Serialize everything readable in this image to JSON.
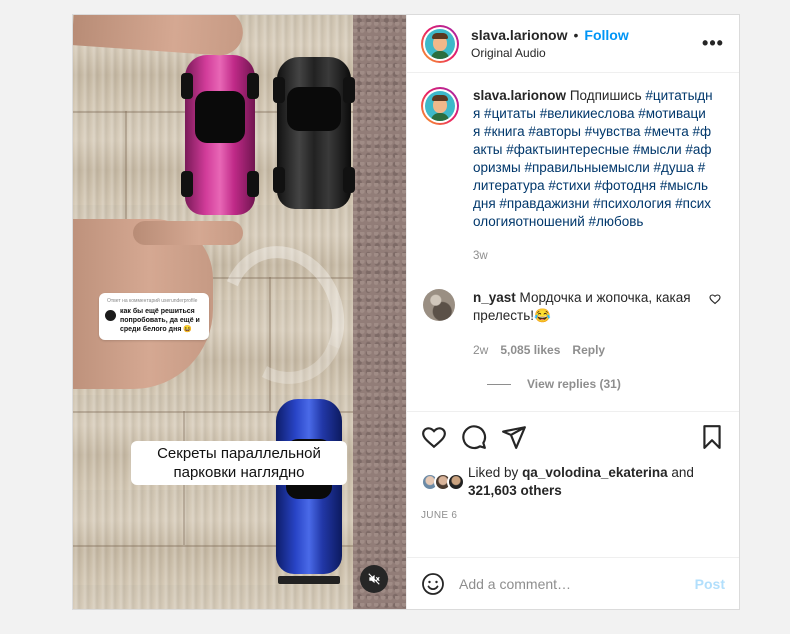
{
  "header": {
    "username": "slava.larionow",
    "separator": "•",
    "follow_label": "Follow",
    "audio_label": "Original Audio",
    "more_label": "•••"
  },
  "media": {
    "reply_card": {
      "header": "Ответ на комментарий userunderprofile",
      "text": "как бы ещё решиться попробовать, да ещё и среди белого дня 😆"
    },
    "overlay_caption": "Секреты параллельной парковки наглядно"
  },
  "caption": {
    "username": "slava.larionow",
    "text": "Подпишись",
    "hashtags": "#цитатыдня #цитаты #великиеслова #мотивация #книга #авторы #чувства #мечта #факты #фактыинтересные #мысли #афоризмы #правильныемысли #душа #литература #стихи #фотодня #мысльдня #правдажизни #психология #психологияотношений #любовь",
    "time": "3w"
  },
  "comment": {
    "username": "n_yast",
    "text": "Мордочка и жопочка, какая прелесть!😂",
    "time": "2w",
    "likes": "5,085 likes",
    "reply_label": "Reply",
    "view_replies": "View replies (31)"
  },
  "likes": {
    "prefix": "Liked by",
    "user": "qa_volodina_ekaterina",
    "and": "and",
    "others": "321,603 others"
  },
  "date": "JUNE 6",
  "add_comment": {
    "placeholder": "Add a comment…",
    "post_label": "Post"
  },
  "colors": {
    "accent": "#0095f6",
    "hashtag": "#00376b",
    "post_disabled": "#b2dffc",
    "muted_text": "#8e8e8e"
  }
}
